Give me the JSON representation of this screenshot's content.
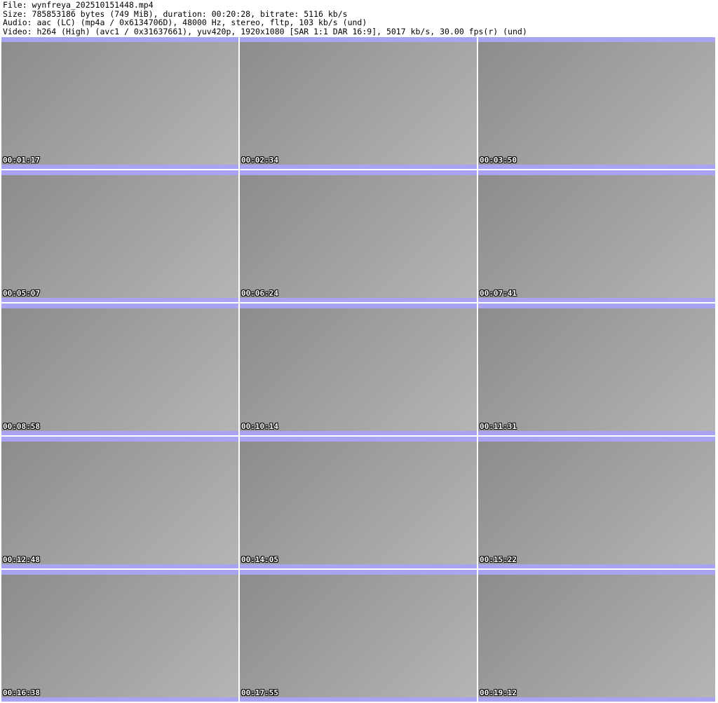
{
  "header": {
    "file": "File: wynfreya_202510151448.mp4",
    "size": "Size: 785853186 bytes (749 MiB), duration: 00:20:28, bitrate: 5116 kb/s",
    "audio": "Audio: aac (LC) (mp4a / 0x6134706D), 48000 Hz, stereo, fltp, 103 kb/s (und)",
    "video": "Video: h264 (High) (avc1 / 0x31637661), yuv420p, 1920x1080 [SAR 1:1 DAR 16:9], 5017 kb/s, 30.00 fps(r) (und)"
  },
  "thumbnails": [
    {
      "timestamp": "00:01:17"
    },
    {
      "timestamp": "00:02:34"
    },
    {
      "timestamp": "00:03:50"
    },
    {
      "timestamp": "00:05:07"
    },
    {
      "timestamp": "00:06:24"
    },
    {
      "timestamp": "00:07:41"
    },
    {
      "timestamp": "00:08:58"
    },
    {
      "timestamp": "00:10:14"
    },
    {
      "timestamp": "00:11:31"
    },
    {
      "timestamp": "00:12:48"
    },
    {
      "timestamp": "00:14:05"
    },
    {
      "timestamp": "00:15:22"
    },
    {
      "timestamp": "00:16:38"
    },
    {
      "timestamp": "00:17:55"
    },
    {
      "timestamp": "00:19:12"
    }
  ]
}
